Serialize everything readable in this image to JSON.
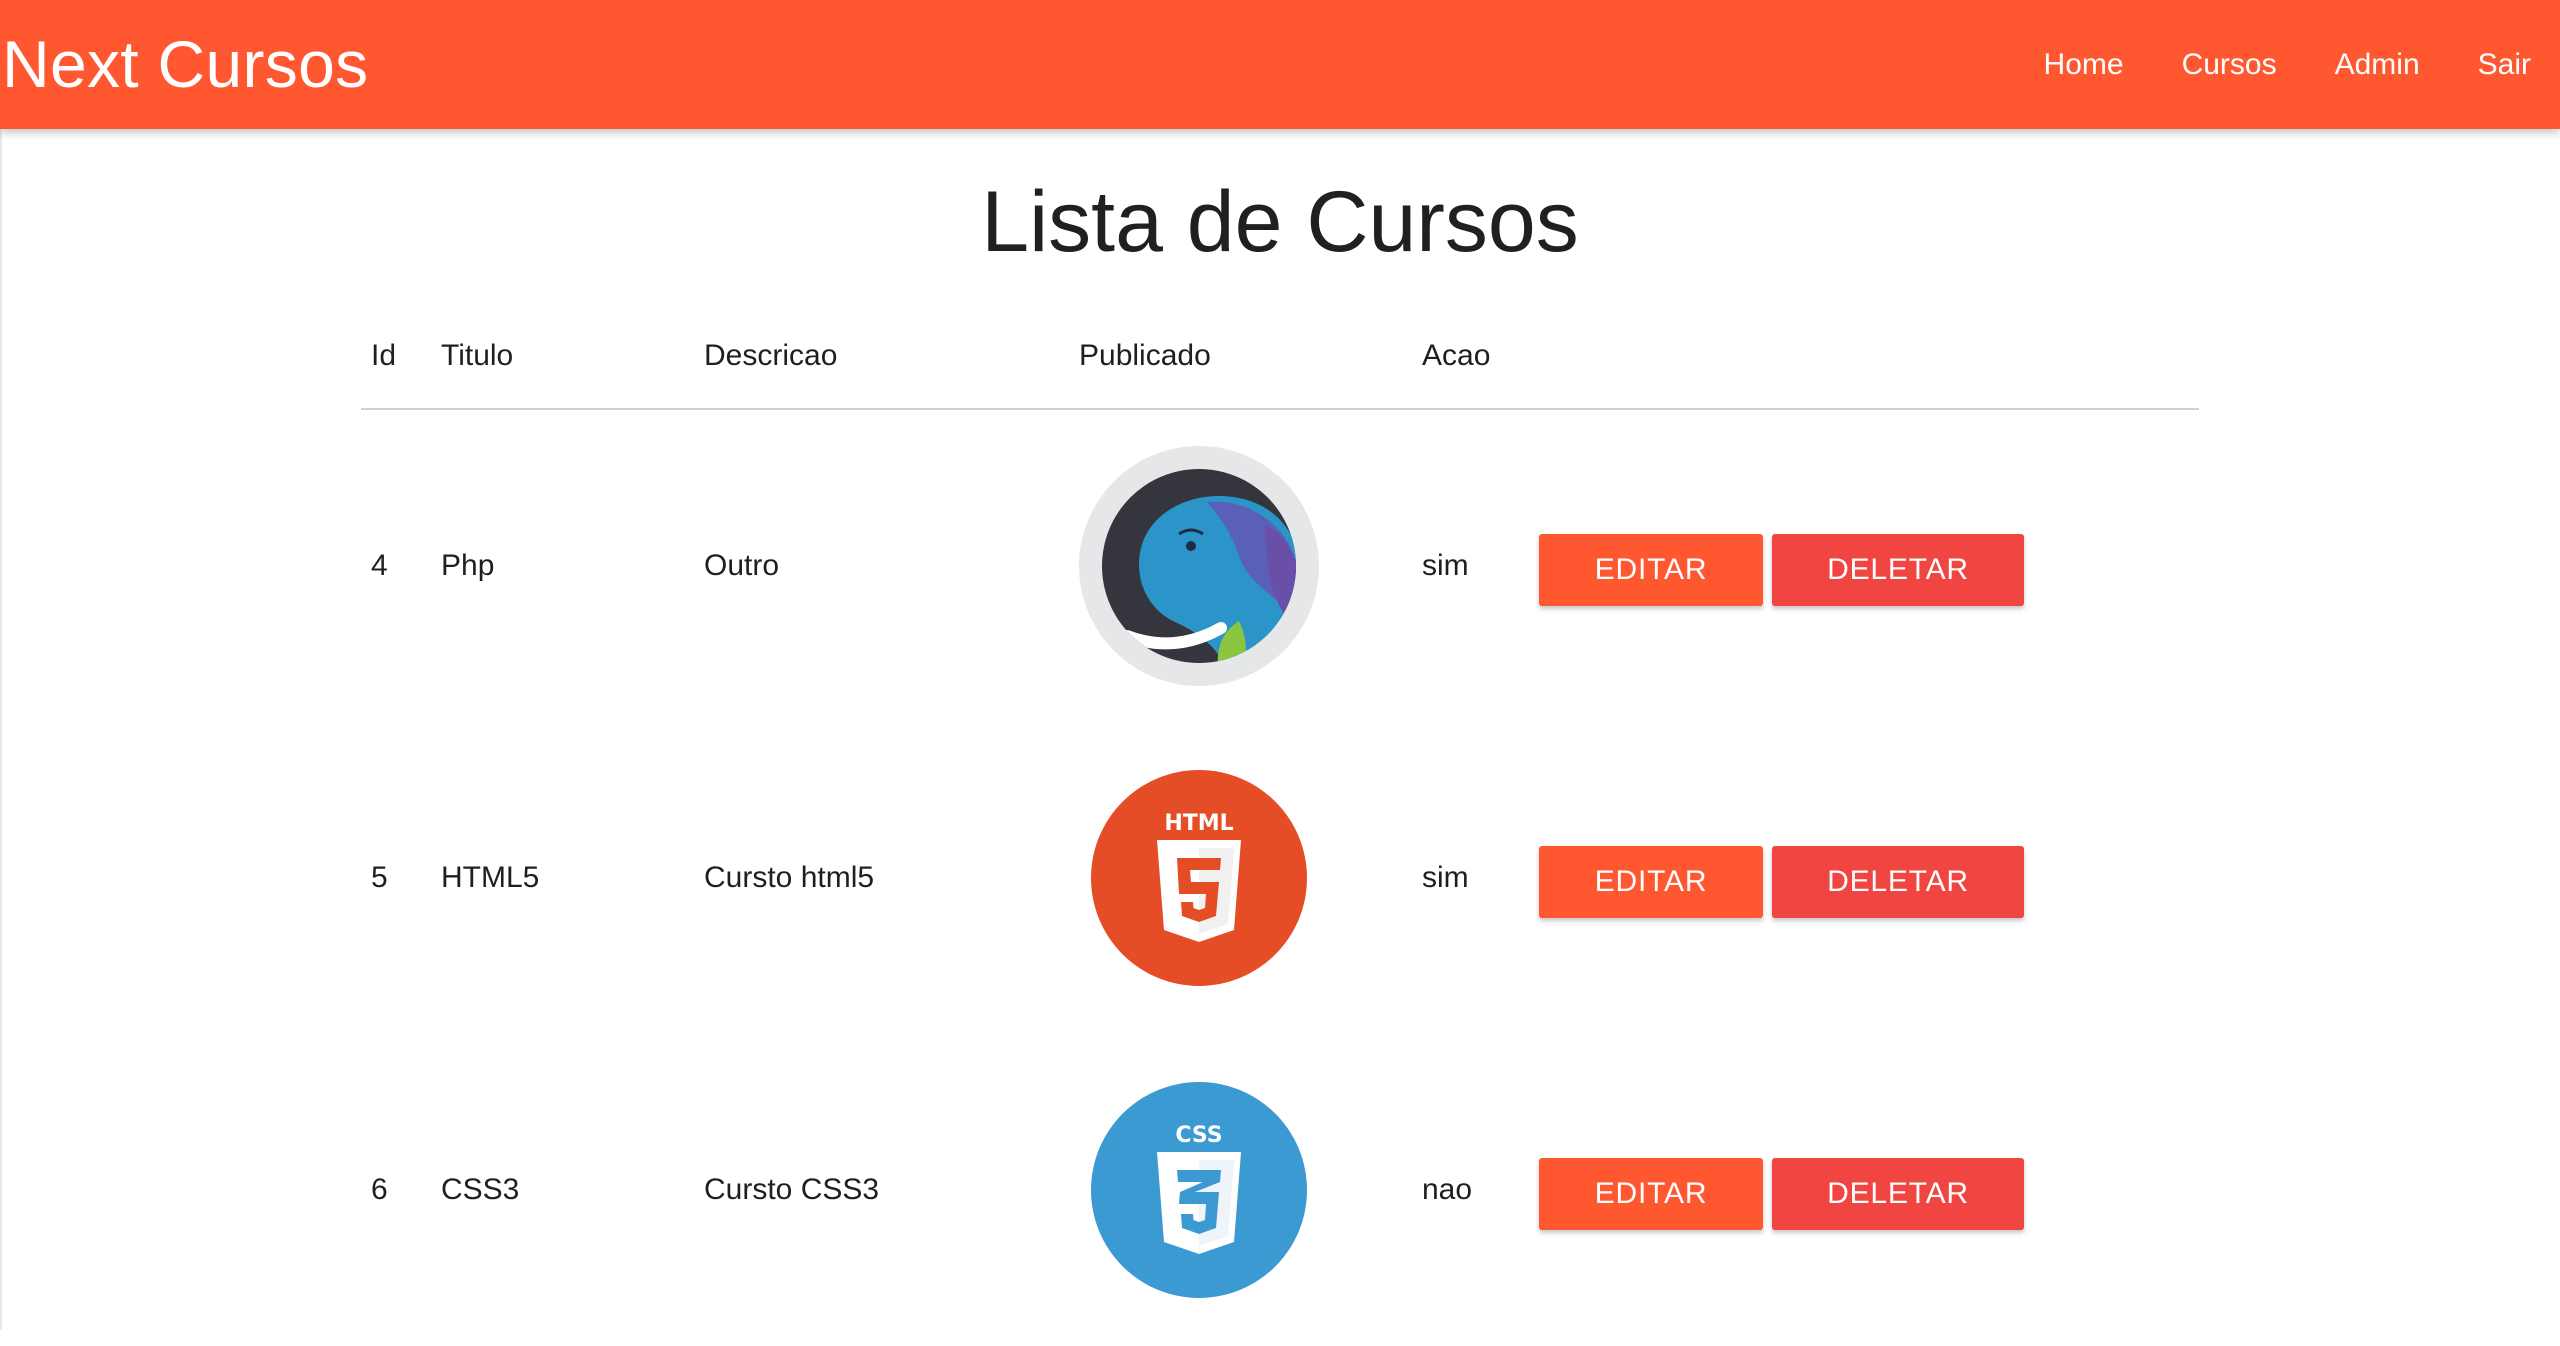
{
  "navbar": {
    "brand": "Next Cursos",
    "links": [
      {
        "label": "Home"
      },
      {
        "label": "Cursos"
      },
      {
        "label": "Admin"
      },
      {
        "label": "Sair"
      }
    ],
    "color": "#ff5830"
  },
  "page": {
    "title": "Lista de Cursos"
  },
  "table": {
    "headers": [
      "Id",
      "Titulo",
      "Descricao",
      "Publicado",
      "Acao"
    ],
    "rows": [
      {
        "id": "4",
        "titulo": "Php",
        "descricao": "Outro",
        "image": "php-elephant-icon",
        "publicado": "sim",
        "edit_label": "EDITAR",
        "delete_label": "DELETAR"
      },
      {
        "id": "5",
        "titulo": "HTML5",
        "descricao": "Cursto html5",
        "image": "html5-logo-icon",
        "publicado": "sim",
        "edit_label": "EDITAR",
        "delete_label": "DELETAR"
      },
      {
        "id": "6",
        "titulo": "CSS3",
        "descricao": "Cursto CSS3",
        "image": "css3-logo-icon",
        "publicado": "nao",
        "edit_label": "EDITAR",
        "delete_label": "DELETAR"
      }
    ]
  },
  "colors": {
    "edit_button": "#ff5830",
    "delete_button": "#f14542",
    "html5": "#e44d26",
    "css3": "#3c9ad2"
  }
}
